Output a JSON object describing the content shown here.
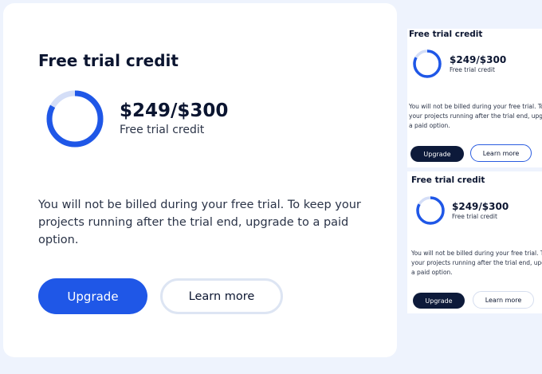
{
  "colors": {
    "background": "#eef3fd",
    "card": "#ffffff",
    "primary": "#1f57e7",
    "dark_button": "#0d1a3a",
    "ring_track": "#d4def7",
    "text": "#0b1530"
  },
  "credit": {
    "used": 249,
    "total": 300,
    "fraction": 0.83
  },
  "main_card": {
    "title": "Free trial credit",
    "amount": "$249/$300",
    "subtitle": "Free trial credit",
    "description": "You will not be billed during your free trial. To keep your projects running after the trial end, upgrade to a paid option.",
    "upgrade_label": "Upgrade",
    "learn_more_label": "Learn more"
  },
  "small_card_1": {
    "title": "Free trial credit",
    "amount": "$249/$300",
    "subtitle": "Free trial credit",
    "description": "You will not be billed during your free trial. To keep your projects running after the trial end, upgrade to a paid option.",
    "upgrade_label": "Upgrade",
    "learn_more_label": "Learn more"
  },
  "small_card_2": {
    "title": "Free trial credit",
    "amount": "$249/$300",
    "subtitle": "Free trial credit",
    "description": "You will not be billed during your free trial. To keep your projects running after the trial end, upgrade to a paid option.",
    "upgrade_label": "Upgrade",
    "learn_more_label": "Learn more"
  }
}
